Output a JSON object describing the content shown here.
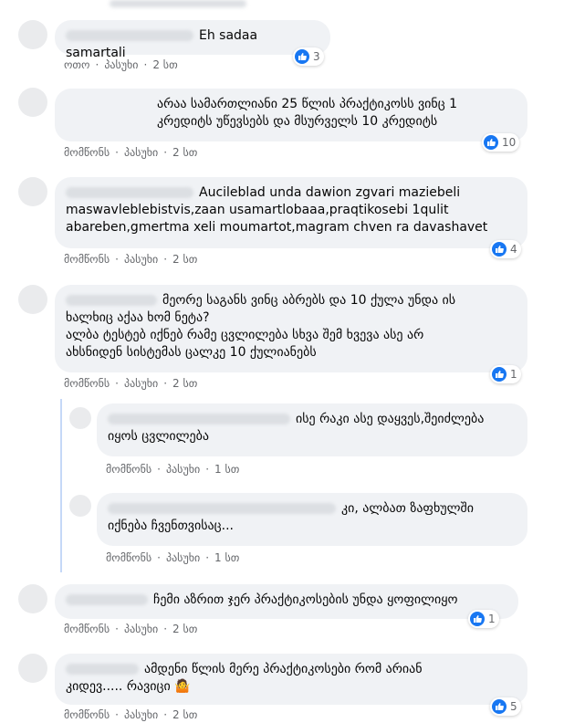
{
  "comments": [
    {
      "text": "Eh sadaa samartali",
      "actions": {
        "like": "ოთო",
        "reply": "პასუხი",
        "time": "2 სთ"
      },
      "reactions": "3"
    },
    {
      "text": "არაა სამართლიანი 25 წლის პრაქტიკოსს ვინც 1\nკრედიტს უწევსებს და მსურველს 10 კრედიტს",
      "actions": {
        "like": "მომწონს",
        "reply": "პასუხი",
        "time": "2 სთ"
      },
      "reactions": "10"
    },
    {
      "text": "Aucileblad unda dawion zgvari maziebeli\nmaswavleblebistvis,zaan usamartlobaaa,praqtikosebi 1qulit\nabareben,gmertma xeli moumartot,magram chven ra davashavet",
      "actions": {
        "like": "მომწონს",
        "reply": "პასუხი",
        "time": "2 სთ"
      },
      "reactions": "4"
    },
    {
      "text": "მეორე საგანს ვინც აბრებს და 10 ქულა უნდა ის\nხალხიც აქაა ხომ ნეტა?\nალბა ტესტებ იქნებ რამე ცვლილება სხვა შემ ხვევა ასე არ\nახსნიდენ სისტემას ცალკე 10 ქულიანებს",
      "actions": {
        "like": "მომწონს",
        "reply": "პასუხი",
        "time": "2 სთ"
      },
      "reactions": "1"
    },
    {
      "text": "ისე რაკი ასე დაყვეს,შეიძლება\nიყოს ცვლილება",
      "actions": {
        "like": "მომწონს",
        "reply": "პასუხი",
        "time": "1 სთ"
      }
    },
    {
      "text": "კი, ალბათ ზაფხულში\nიქნება ჩვენთვისაც...",
      "actions": {
        "like": "მომწონს",
        "reply": "პასუხი",
        "time": "1 სთ"
      }
    },
    {
      "text": "ჩემი აზრით ჯერ პრაქტიკოსების უნდა ყოფილიყო",
      "actions": {
        "like": "მომწონს",
        "reply": "პასუხი",
        "time": "2 სთ"
      },
      "reactions": "1"
    },
    {
      "text": "ამდენი წლის მერე პრაქტიკოსები რომ არიან\nკიდევ..... რავიცი 🤷",
      "actions": {
        "like": "მომწონს",
        "reply": "პასუხი",
        "time": "2 სთ"
      },
      "reactions": "5"
    }
  ],
  "colors": {
    "like_blue": "#1877f2",
    "bubble_bg": "#f0f2f5",
    "meta_gray": "#65676b",
    "thread_line": "#c5d8f7"
  },
  "icons": {
    "reaction": "like-icon"
  }
}
